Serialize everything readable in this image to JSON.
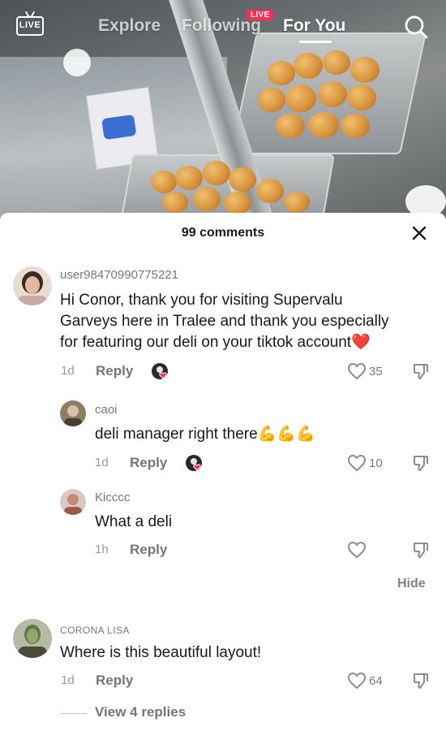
{
  "nav": {
    "live_label": "LIVE",
    "tabs": [
      {
        "label": "Explore"
      },
      {
        "label": "Following"
      },
      {
        "label": "For You"
      }
    ],
    "live_badge": "LIVE",
    "icons": {
      "search": "search-icon",
      "live": "live-tv-icon"
    }
  },
  "sheet": {
    "title": "99 comments",
    "close_icon": "close-icon"
  },
  "comments": [
    {
      "username": "user98470990775221",
      "text_line1": "Hi Conor, thank you for visiting Supervalu",
      "text_line2": "Garveys here in Tralee and thank you especially",
      "text_line3": "for featuring our deli on your tiktok account",
      "emoji": "❤️",
      "time": "1d",
      "reply_label": "Reply",
      "likes": "35",
      "replies": [
        {
          "username": "caoi",
          "text": "deli manager right there",
          "emoji": "💪💪💪",
          "time": "1d",
          "reply_label": "Reply",
          "likes": "10"
        },
        {
          "username": "Kicccc",
          "text": "What a deli",
          "time": "1h",
          "reply_label": "Reply",
          "likes": ""
        }
      ],
      "hide_label": "Hide"
    },
    {
      "username": "CORONA LISA",
      "text": "Where is this beautiful layout!",
      "time": "1d",
      "reply_label": "Reply",
      "likes": "64",
      "view_replies": "View 4 replies"
    }
  ],
  "colors": {
    "accent": "#fe2c55",
    "text": "#161823",
    "muted": "#8a8b91"
  }
}
